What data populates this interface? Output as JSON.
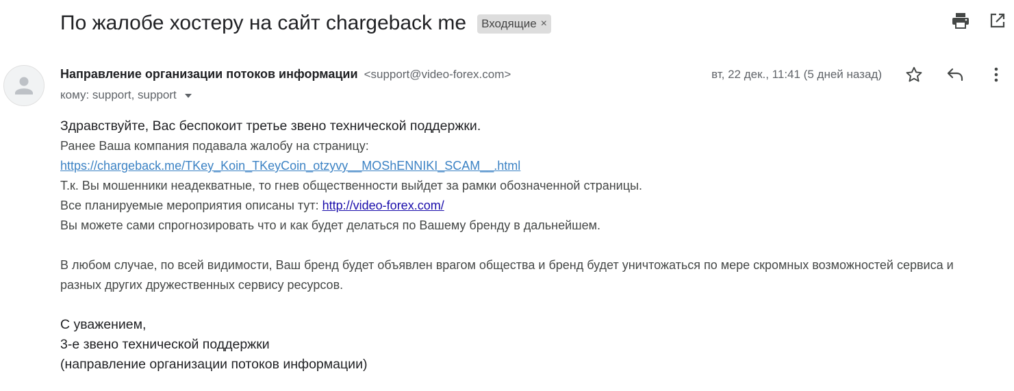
{
  "email": {
    "subject": "По жалобе хостеру на сайт chargeback me",
    "label": "Входящие",
    "label_remove": "×",
    "toolbar": {
      "print_icon": "print-icon",
      "open_new_window_icon": "open-in-new-window-icon"
    },
    "sender": {
      "name": "Направление организации потоков информации",
      "email": "<support@video-forex.com>"
    },
    "recipients": "кому: support, support",
    "date": "вт, 22 дек., 11:41 (5 дней назад)",
    "actions": {
      "star_icon": "star-icon",
      "reply_icon": "reply-icon",
      "more_icon": "more-vertical-icon"
    },
    "body": {
      "greeting": "Здравствуйте, Вас беспокоит третье звено технической поддержки.",
      "line1": "Ранее Ваша компания подавала жалобу на страницу:",
      "link1": "https://chargeback.me/TKey_Koin_TKeyCoin_otzyvy__MOShENNIKI_SCAM__.html",
      "line2": "Т.к. Вы мошенники неадекватные, то гнев общественности выйдет за рамки обозначенной страницы.",
      "line3_prefix": "Все планируемые мероприятия описаны тут: ",
      "link2": "http://video-forex.com/",
      "line4": "Вы можете сами спрогнозировать что и как будет делаться по Вашему бренду в дальнейшем.",
      "paragraph2": "В любом случае, по всей видимости, Ваш бренд будет объявлен врагом общества и бренд будет уничтожаться по мере скромных возможностей сервиса и разных других дружественных сервису ресурсов.",
      "signoff": "С уважением,",
      "signature1": "3-е звено технической поддержки",
      "signature2": "(направление организации потоков информации)"
    }
  }
}
